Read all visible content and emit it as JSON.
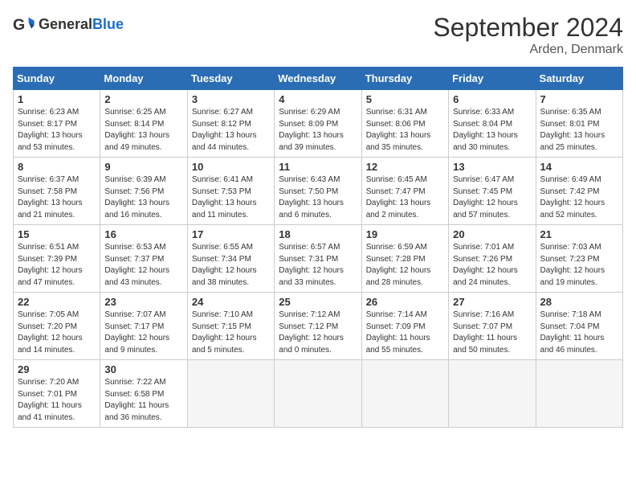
{
  "header": {
    "logo_general": "General",
    "logo_blue": "Blue",
    "title": "September 2024",
    "subtitle": "Arden, Denmark"
  },
  "weekdays": [
    "Sunday",
    "Monday",
    "Tuesday",
    "Wednesday",
    "Thursday",
    "Friday",
    "Saturday"
  ],
  "weeks": [
    [
      {
        "day": "1",
        "sunrise": "6:23 AM",
        "sunset": "8:17 PM",
        "daylight": "13 hours and 53 minutes."
      },
      {
        "day": "2",
        "sunrise": "6:25 AM",
        "sunset": "8:14 PM",
        "daylight": "13 hours and 49 minutes."
      },
      {
        "day": "3",
        "sunrise": "6:27 AM",
        "sunset": "8:12 PM",
        "daylight": "13 hours and 44 minutes."
      },
      {
        "day": "4",
        "sunrise": "6:29 AM",
        "sunset": "8:09 PM",
        "daylight": "13 hours and 39 minutes."
      },
      {
        "day": "5",
        "sunrise": "6:31 AM",
        "sunset": "8:06 PM",
        "daylight": "13 hours and 35 minutes."
      },
      {
        "day": "6",
        "sunrise": "6:33 AM",
        "sunset": "8:04 PM",
        "daylight": "13 hours and 30 minutes."
      },
      {
        "day": "7",
        "sunrise": "6:35 AM",
        "sunset": "8:01 PM",
        "daylight": "13 hours and 25 minutes."
      }
    ],
    [
      {
        "day": "8",
        "sunrise": "6:37 AM",
        "sunset": "7:58 PM",
        "daylight": "13 hours and 21 minutes."
      },
      {
        "day": "9",
        "sunrise": "6:39 AM",
        "sunset": "7:56 PM",
        "daylight": "13 hours and 16 minutes."
      },
      {
        "day": "10",
        "sunrise": "6:41 AM",
        "sunset": "7:53 PM",
        "daylight": "13 hours and 11 minutes."
      },
      {
        "day": "11",
        "sunrise": "6:43 AM",
        "sunset": "7:50 PM",
        "daylight": "13 hours and 6 minutes."
      },
      {
        "day": "12",
        "sunrise": "6:45 AM",
        "sunset": "7:47 PM",
        "daylight": "13 hours and 2 minutes."
      },
      {
        "day": "13",
        "sunrise": "6:47 AM",
        "sunset": "7:45 PM",
        "daylight": "12 hours and 57 minutes."
      },
      {
        "day": "14",
        "sunrise": "6:49 AM",
        "sunset": "7:42 PM",
        "daylight": "12 hours and 52 minutes."
      }
    ],
    [
      {
        "day": "15",
        "sunrise": "6:51 AM",
        "sunset": "7:39 PM",
        "daylight": "12 hours and 47 minutes."
      },
      {
        "day": "16",
        "sunrise": "6:53 AM",
        "sunset": "7:37 PM",
        "daylight": "12 hours and 43 minutes."
      },
      {
        "day": "17",
        "sunrise": "6:55 AM",
        "sunset": "7:34 PM",
        "daylight": "12 hours and 38 minutes."
      },
      {
        "day": "18",
        "sunrise": "6:57 AM",
        "sunset": "7:31 PM",
        "daylight": "12 hours and 33 minutes."
      },
      {
        "day": "19",
        "sunrise": "6:59 AM",
        "sunset": "7:28 PM",
        "daylight": "12 hours and 28 minutes."
      },
      {
        "day": "20",
        "sunrise": "7:01 AM",
        "sunset": "7:26 PM",
        "daylight": "12 hours and 24 minutes."
      },
      {
        "day": "21",
        "sunrise": "7:03 AM",
        "sunset": "7:23 PM",
        "daylight": "12 hours and 19 minutes."
      }
    ],
    [
      {
        "day": "22",
        "sunrise": "7:05 AM",
        "sunset": "7:20 PM",
        "daylight": "12 hours and 14 minutes."
      },
      {
        "day": "23",
        "sunrise": "7:07 AM",
        "sunset": "7:17 PM",
        "daylight": "12 hours and 9 minutes."
      },
      {
        "day": "24",
        "sunrise": "7:10 AM",
        "sunset": "7:15 PM",
        "daylight": "12 hours and 5 minutes."
      },
      {
        "day": "25",
        "sunrise": "7:12 AM",
        "sunset": "7:12 PM",
        "daylight": "12 hours and 0 minutes."
      },
      {
        "day": "26",
        "sunrise": "7:14 AM",
        "sunset": "7:09 PM",
        "daylight": "11 hours and 55 minutes."
      },
      {
        "day": "27",
        "sunrise": "7:16 AM",
        "sunset": "7:07 PM",
        "daylight": "11 hours and 50 minutes."
      },
      {
        "day": "28",
        "sunrise": "7:18 AM",
        "sunset": "7:04 PM",
        "daylight": "11 hours and 46 minutes."
      }
    ],
    [
      {
        "day": "29",
        "sunrise": "7:20 AM",
        "sunset": "7:01 PM",
        "daylight": "11 hours and 41 minutes."
      },
      {
        "day": "30",
        "sunrise": "7:22 AM",
        "sunset": "6:58 PM",
        "daylight": "11 hours and 36 minutes."
      },
      null,
      null,
      null,
      null,
      null
    ]
  ]
}
